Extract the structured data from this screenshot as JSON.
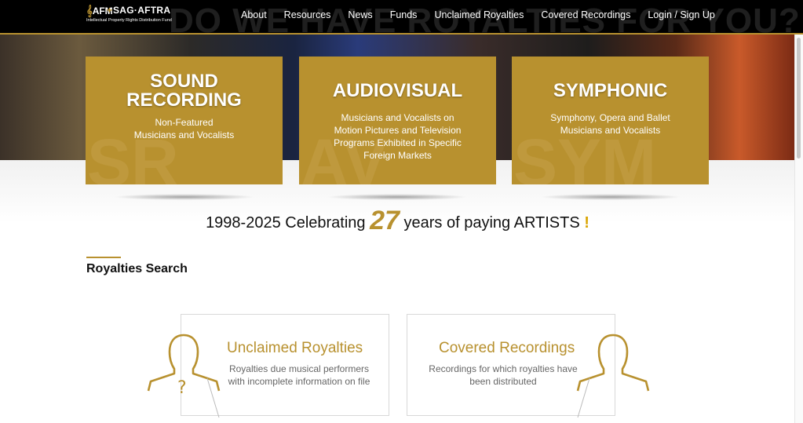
{
  "header": {
    "logo": {
      "afm": "AFM",
      "plus": "+",
      "sag": "SAG·AFTRA",
      "sub": "Intellectual Property Rights Distribution Fund"
    },
    "background_headline": "DO WE HAVE ROYALTIES FOR YOU?",
    "menu": [
      "About",
      "Resources",
      "News",
      "Funds",
      "Unclaimed Royalties",
      "Covered Recordings",
      "Login / Sign Up"
    ]
  },
  "cards": [
    {
      "title_line1": "SOUND",
      "title_line2": "RECORDING",
      "desc_line1": "Non-Featured",
      "desc_line2": "Musicians and Vocalists",
      "desc_line3": "",
      "desc_line4": "",
      "bg": "SR"
    },
    {
      "title_line1": "AUDIOVISUAL",
      "title_line2": "",
      "desc_line1": "Musicians and Vocalists on",
      "desc_line2": "Motion Pictures and Television",
      "desc_line3": "Programs Exhibited in Specific",
      "desc_line4": "Foreign Markets",
      "bg": "AV"
    },
    {
      "title_line1": "SYMPHONIC",
      "title_line2": "",
      "desc_line1": "Symphony, Opera and Ballet",
      "desc_line2": "Musicians and Vocalists",
      "desc_line3": "",
      "desc_line4": "",
      "bg": "SYM"
    }
  ],
  "celebrate": {
    "prefix": "1998-2025 Celebrating",
    "number": "27",
    "suffix": "years of paying ARTISTS",
    "mark": "!"
  },
  "royalties_search": {
    "title": "Royalties Search",
    "panels": [
      {
        "title": "Unclaimed Royalties",
        "desc_line1": "Royalties due musical performers",
        "desc_line2": "with incomplete information on file",
        "icon_glyph": "?"
      },
      {
        "title": "Covered Recordings",
        "desc_line1": "Recordings for which royalties have",
        "desc_line2": "been distributed"
      }
    ]
  },
  "colors": {
    "accent": "#b8912f",
    "nav_bg": "#000000"
  }
}
